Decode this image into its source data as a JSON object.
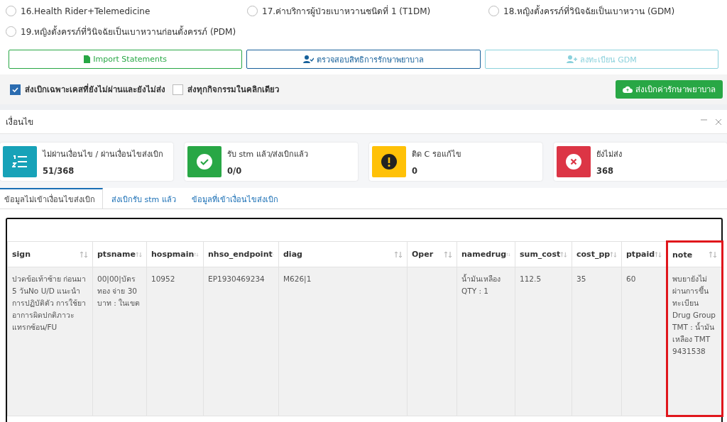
{
  "options": [
    {
      "label": "16.Health Rider+Telemedicine",
      "selected": false
    },
    {
      "label": "17.ค่าบริการผู้ป่วยเบาหวานชนิดที่ 1 (T1DM)",
      "selected": false
    },
    {
      "label": "18.หญิงตั้งครรภ์ที่วินิจฉัยเป็นเบาหวาน (GDM)",
      "selected": false
    },
    {
      "label": "19.หญิงตั้งครรภ์ที่วินิจฉัยเป็นเบาหวานก่อนตั้งครรภ์ (PDM)",
      "selected": false
    }
  ],
  "actions": [
    {
      "label": "Import Statements",
      "kind": "file",
      "color": "#28a745"
    },
    {
      "label": "ตรวจสอบสิทธิการรักษาพยาบาล",
      "kind": "usercheck",
      "color": "#17609a"
    },
    {
      "label": "ลงทะเบียน GDM",
      "kind": "useradd",
      "color": "#8bd1dc"
    }
  ],
  "send_options": [
    {
      "label": "ส่งเบิกเฉพาะเคสที่ยังไม่ผ่านและยังไม่ส่ง",
      "checked": true
    },
    {
      "label": "ส่งทุกกิจกรรมในคลิกเดียว",
      "checked": false
    }
  ],
  "send_button": {
    "label": "ส่งเบิกค่ารักษาพยาบาล"
  },
  "panel": {
    "title": "เงื่อนไข",
    "stats": [
      {
        "label": "ไม่ผ่านเงื่อนไข / ผ่านเงื่อนไขส่งเบิก",
        "value": "51/368",
        "kind": "list",
        "color": "#17a2b8"
      },
      {
        "label": "รับ stm แล้ว/ส่งเบิกแล้ว",
        "value": "0/0",
        "kind": "check",
        "color": "#28a745"
      },
      {
        "label": "ติด C รอแก้ไข",
        "value": "0",
        "kind": "alert",
        "color": "#ffc107"
      },
      {
        "label": "ยังไม่ส่ง",
        "value": "368",
        "kind": "cross",
        "color": "#dc3545"
      }
    ],
    "tabs": [
      {
        "label": "ข้อมูลไม่เข้าเงื่อนไขส่งเบิก",
        "selected": true
      },
      {
        "label": "ส่งเบิกรับ stm แล้ว",
        "selected": false
      },
      {
        "label": "ข้อมูลที่เข้าเงื่อนไขส่งเบิก",
        "selected": false
      }
    ]
  },
  "table": {
    "columns": [
      {
        "label": "sign",
        "highlighted": false
      },
      {
        "label": "ptsname",
        "highlighted": false
      },
      {
        "label": "hospmain",
        "highlighted": false
      },
      {
        "label": "nhso_endpoint",
        "highlighted": false
      },
      {
        "label": "diag",
        "highlighted": false
      },
      {
        "label": "Oper",
        "highlighted": false
      },
      {
        "label": "namedrug",
        "highlighted": false
      },
      {
        "label": "sum_cost",
        "highlighted": false
      },
      {
        "label": "cost_pp",
        "highlighted": false
      },
      {
        "label": "ptpaid",
        "highlighted": false
      },
      {
        "label": "note",
        "highlighted": true
      }
    ],
    "rows": [
      [
        "ปวดข้อเท้าซ้าย ก่อนมา 5 วันNo U/D แนะนำการปฏิบัติตัว การใช้ยา อาการผิดปกติภาวะแทรกซ้อน/FU",
        "00|00|บัตรทอง จ่าย 30 บาท : ในเขต",
        "10952",
        "EP1930469234",
        "M626|1",
        "",
        "น้ำมันเหลือง QTY : 1",
        "112.5",
        "35",
        "60",
        "พบยายังไม่ผ่านการขึ้นทะเบียน Drug Group TMT : น้ำมันเหลือง TMT 9431538"
      ]
    ]
  }
}
